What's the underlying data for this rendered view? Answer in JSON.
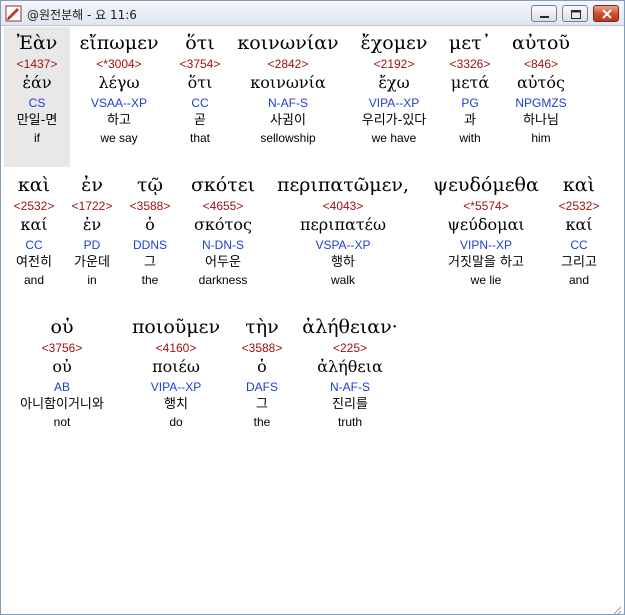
{
  "window": {
    "title": "@원전분해 - 요 11:6"
  },
  "rows": [
    [
      {
        "greek": "Ἐὰν",
        "strong": "<1437>",
        "lemma": "ἐάν",
        "parse": "CS",
        "korean": "만일-면",
        "english": "if"
      },
      {
        "greek": "εἴπωμεν",
        "strong": "<*3004>",
        "lemma": "λέγω",
        "parse": "VSAA--XP",
        "korean": "하고",
        "english": "we say"
      },
      {
        "greek": "ὅτι",
        "strong": "<3754>",
        "lemma": "ὅτι",
        "parse": "CC",
        "korean": "곧",
        "english": "that"
      },
      {
        "greek": "κοινωνίαν",
        "strong": "<2842>",
        "lemma": "κοινωνία",
        "parse": "N-AF-S",
        "korean": "사귐이",
        "english": "sellowship"
      },
      {
        "greek": "ἔχομεν",
        "strong": "<2192>",
        "lemma": "ἔχω",
        "parse": "VIPA--XP",
        "korean": "우리가-있다",
        "english": "we have"
      },
      {
        "greek": "μετ᾽",
        "strong": "<3326>",
        "lemma": "μετά",
        "parse": "PG",
        "korean": "과",
        "english": "with"
      },
      {
        "greek": "αὐτοῦ",
        "strong": "<846>",
        "lemma": "αὐτός",
        "parse": "NPGMZS",
        "korean": "하나님",
        "english": "him"
      }
    ],
    [
      {
        "greek": "καὶ",
        "strong": "<2532>",
        "lemma": "καί",
        "parse": "CC",
        "korean": "여전히",
        "english": "and"
      },
      {
        "greek": "ἐν",
        "strong": "<1722>",
        "lemma": "ἐν",
        "parse": "PD",
        "korean": "가운데",
        "english": "in"
      },
      {
        "greek": "τῷ",
        "strong": "<3588>",
        "lemma": "ὁ",
        "parse": "DDNS",
        "korean": "그",
        "english": "the"
      },
      {
        "greek": "σκότει",
        "strong": "<4655>",
        "lemma": "σκότος",
        "parse": "N-DN-S",
        "korean": "어두운",
        "english": "darkness"
      },
      {
        "greek": "περιπατῶμεν,",
        "strong": "<4043>",
        "lemma": "περιπατέω",
        "parse": "VSPA--XP",
        "korean": "행하",
        "english": "walk"
      },
      {
        "greek": "ψευδόμεθα",
        "strong": "<*5574>",
        "lemma": "ψεύδομαι",
        "parse": "VIPN--XP",
        "korean": "거짓말을 하고",
        "english": "we lie"
      },
      {
        "greek": "καὶ",
        "strong": "<2532>",
        "lemma": "καί",
        "parse": "CC",
        "korean": "그리고",
        "english": "and"
      }
    ],
    [
      {
        "greek": "οὐ",
        "strong": "<3756>",
        "lemma": "οὐ",
        "parse": "AB",
        "korean": "아니함이거니와",
        "english": "not"
      },
      {
        "greek": "ποιοῦμεν",
        "strong": "<4160>",
        "lemma": "ποιέω",
        "parse": "VIPA--XP",
        "korean": "행치",
        "english": "do"
      },
      {
        "greek": "τὴν",
        "strong": "<3588>",
        "lemma": "ὁ",
        "parse": "DAFS",
        "korean": "그",
        "english": "the"
      },
      {
        "greek": "ἀλήθειαν·",
        "strong": "<225>",
        "lemma": "ἀλήθεια",
        "parse": "N-AF-S",
        "korean": "진리를",
        "english": "truth"
      }
    ]
  ]
}
